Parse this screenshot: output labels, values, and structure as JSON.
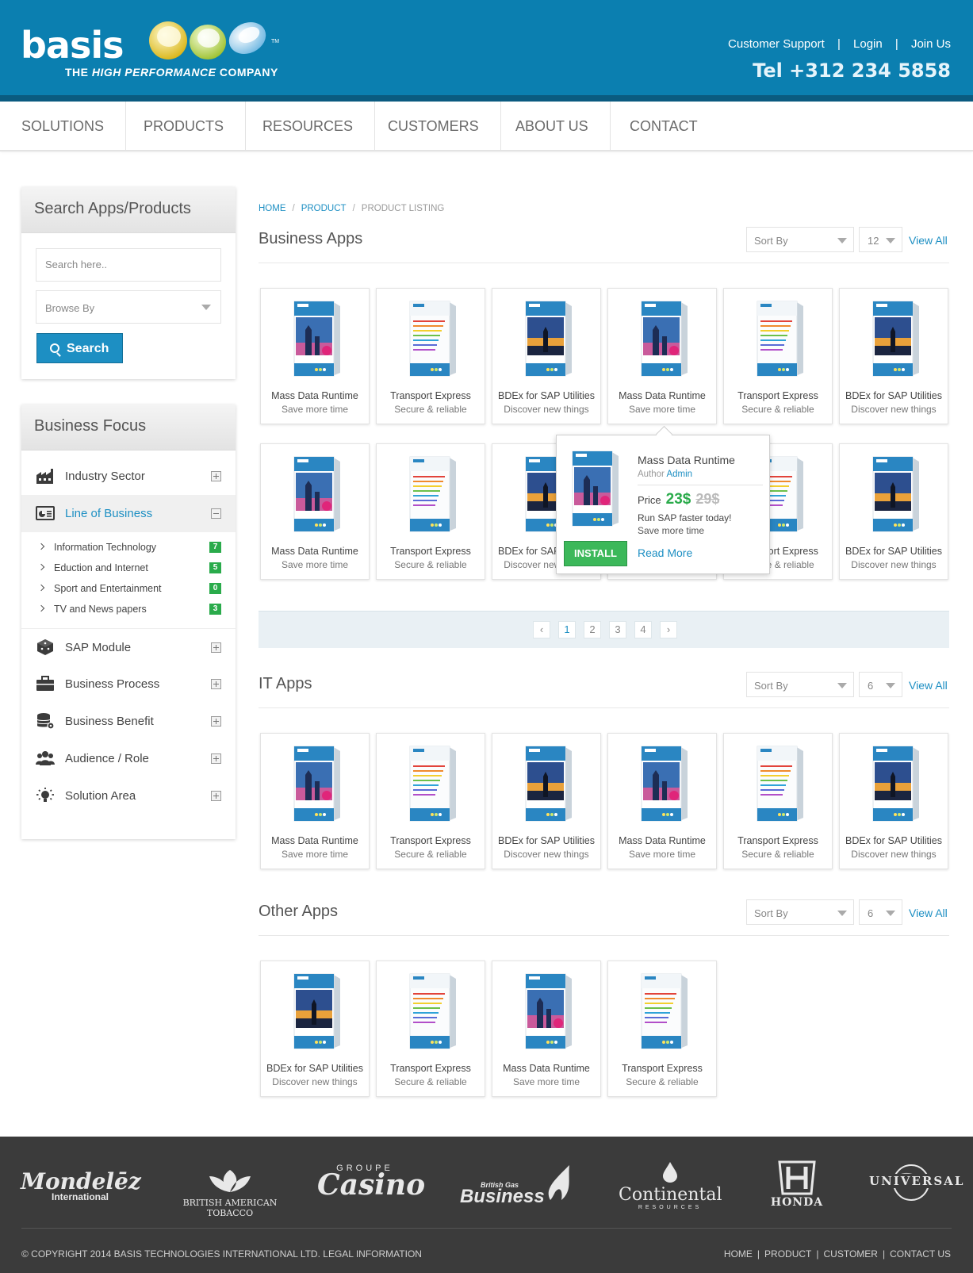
{
  "header": {
    "logo_text": "basis",
    "logo_tagline_pre": "THE ",
    "logo_tagline_bold": "HIGH PERFORMANCE",
    "logo_tagline_post": " COMPANY",
    "tm": "TM",
    "links": [
      "Customer Support",
      "Login",
      "Join Us"
    ],
    "separator": "|",
    "tel": "Tel +312 234 5858"
  },
  "nav": [
    "SOLUTIONS",
    "PRODUCTS",
    "RESOURCES",
    "CUSTOMERS",
    "ABOUT US",
    "CONTACT"
  ],
  "sidebar": {
    "search_title": "Search Apps/Products",
    "search_placeholder": "Search here..",
    "browse_label": "Browse By",
    "search_button": "Search",
    "focus_title": "Business Focus",
    "focus_items": [
      {
        "label": "Industry Sector",
        "icon": "factory-icon"
      },
      {
        "label": "Line of Business",
        "icon": "chart-card-icon"
      },
      {
        "label": "SAP Module",
        "icon": "cube-icon"
      },
      {
        "label": "Business Process",
        "icon": "briefcase-icon"
      },
      {
        "label": "Business Benefit",
        "icon": "database-gear-icon"
      },
      {
        "label": "Audience / Role",
        "icon": "people-icon"
      },
      {
        "label": "Solution Area",
        "icon": "lightbulb-icon"
      }
    ],
    "sub_items": [
      {
        "label": "Information Technology",
        "count": "7"
      },
      {
        "label": "Eduction and Internet",
        "count": "5"
      },
      {
        "label": "Sport and Entertainment",
        "count": "0"
      },
      {
        "label": "TV and News papers",
        "count": "3"
      }
    ]
  },
  "breadcrumb": [
    "HOME",
    "PRODUCT",
    "PRODUCT LISTING"
  ],
  "breadcrumb_sep": "/",
  "sections": {
    "business": {
      "title": "Business Apps",
      "sort": "Sort By",
      "count": "12",
      "view_all": "View All"
    },
    "it": {
      "title": "IT Apps",
      "sort": "Sort By",
      "count": "6",
      "view_all": "View All"
    },
    "other": {
      "title": "Other Apps",
      "sort": "Sort By",
      "count": "6",
      "view_all": "View All"
    }
  },
  "products": {
    "mass": {
      "name": "Mass Data Runtime",
      "tag": "Save more time"
    },
    "transport": {
      "name": "Transport Express",
      "tag": "Secure & reliable"
    },
    "bdex": {
      "name": "BDEx for SAP Utilities",
      "tag": "Discover new things"
    }
  },
  "pagination": {
    "pages": [
      "1",
      "2",
      "3",
      "4"
    ],
    "prev": "‹",
    "next": "›"
  },
  "tooltip": {
    "name": "Mass Data Runtime",
    "author_label": "Author",
    "author": "Admin",
    "price_label": "Price",
    "price": "23$",
    "old_price": "29$",
    "desc": "Run SAP faster today!",
    "tag": "Save more time",
    "install": "INSTALL",
    "read_more": "Read More"
  },
  "footer": {
    "brands": [
      "Mondelēz",
      "International",
      "BRITISH AMERICAN",
      "TOBACCO",
      "GROUPE",
      "Casino",
      "British Gas",
      "Business",
      "Continental",
      "RESOURCES",
      "HONDA",
      "UNIVERSAL"
    ],
    "copyright": "© COPYRIGHT 2014 BASIS TECHNOLOGIES INTERNATIONAL LTD. LEGAL INFORMATION",
    "links": [
      "HOME",
      "PRODUCT",
      "CUSTOMER",
      "CONTACT US"
    ],
    "separator": "|"
  },
  "colors": {
    "brand_blue": "#0b7fb0",
    "accent_blue": "#1d8fc3",
    "green": "#2aab4b",
    "footer": "#3b3b3b"
  }
}
